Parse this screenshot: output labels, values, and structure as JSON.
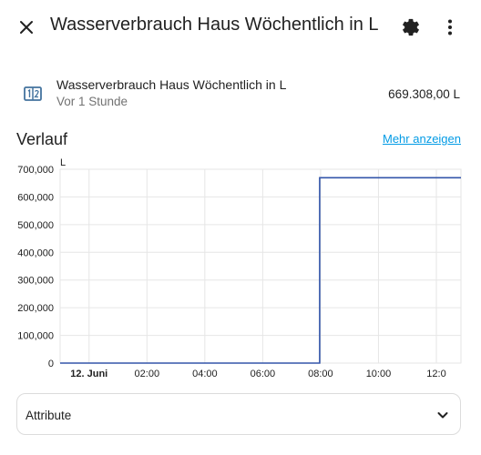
{
  "header": {
    "title": "Wasserverbrauch Haus Wöchentlich in L",
    "close_icon": "close-icon",
    "settings_icon": "gear-icon",
    "menu_icon": "more-vertical-icon"
  },
  "entity": {
    "icon": "counter-icon",
    "name": "Wasserverbrauch Haus Wöchentlich in L",
    "last_changed": "Vor 1 Stunde",
    "value": "669.308,00 L"
  },
  "history": {
    "title": "Verlauf",
    "more_link": "Mehr anzeigen"
  },
  "chart_data": {
    "type": "line",
    "unit": "L",
    "y_ticks": [
      "700,000",
      "600,000",
      "500,000",
      "400,000",
      "300,000",
      "200,000",
      "100,000",
      "0"
    ],
    "x_ticks": [
      "12. Juni",
      "02:00",
      "04:00",
      "06:00",
      "08:00",
      "10:00",
      "12:0"
    ],
    "ylim": [
      0,
      700000
    ],
    "series": [
      {
        "color": "#3355aa",
        "x": [
          "11.06 23:00",
          "12.06 07:58",
          "12.06 07:58",
          "12.06 13:00"
        ],
        "values": [
          0,
          0,
          669308,
          669308
        ]
      }
    ]
  },
  "attributes": {
    "label": "Attribute",
    "chevron_icon": "chevron-down-icon"
  }
}
